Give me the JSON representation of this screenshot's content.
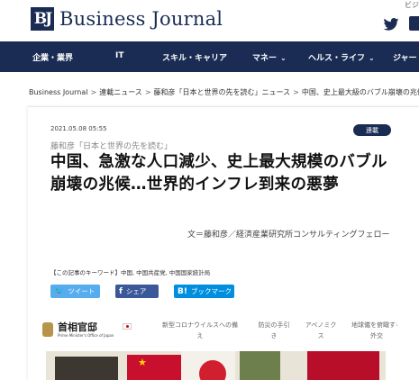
{
  "header": {
    "logo_mark": "BJ",
    "logo_text": "Business Journal",
    "top_right_text": "ビジ",
    "icons": [
      "twitter-icon",
      "facebook-icon"
    ]
  },
  "nav": {
    "items": [
      {
        "label": "企業・業界",
        "dropdown": false
      },
      {
        "label": "IT",
        "dropdown": false
      },
      {
        "label": "スキル・キャリア",
        "dropdown": false
      },
      {
        "label": "マネー",
        "dropdown": true
      },
      {
        "label": "ヘルス・ライフ",
        "dropdown": true
      },
      {
        "label": "ジャー",
        "dropdown": false
      }
    ],
    "chevron": "⌄",
    "background": "#1a2c54"
  },
  "breadcrumb": {
    "items": [
      "Business Journal",
      "連載ニュース",
      "藤和彦「日本と世界の先を読む」ニュース",
      "中国、史上最大級のバブル崩壊の兆候"
    ],
    "separator": ">"
  },
  "article": {
    "date": "2021.05.08 05:55",
    "badge": "連載",
    "series": "藤和彦「日本と世界の先を読む」",
    "title": "中国、急激な人口減少、史上最大規模のバブル崩壊の兆候…世界的インフレ到来の悪夢",
    "byline": "文＝藤和彦／経済産業研究所コンサルティングフェロー",
    "keywords_label": "【この記事のキーワード】",
    "keywords": [
      "中国",
      "中国共産党",
      "中国国家統計局"
    ]
  },
  "share": {
    "twitter": {
      "icon": "twitter-icon",
      "glyph": "🐦",
      "label": "ツイート",
      "color": "#55acee"
    },
    "facebook": {
      "icon": "facebook-icon",
      "glyph": "f",
      "label": "シェア",
      "color": "#3b5998"
    },
    "hatena": {
      "icon": "hatena-bookmark-icon",
      "glyph": "B!",
      "label": "ブックマーク",
      "color": "#008fde"
    }
  },
  "embedded_image": {
    "site_name": "首相官邸",
    "site_sub": "Prime Minister's Office of Japan",
    "nav": [
      {
        "line1": "新型コロナウイルスへの備",
        "line2": "え"
      },
      {
        "line1": "防災の手引",
        "line2": "き"
      },
      {
        "line1": "アベノミク",
        "line2": "ス"
      },
      {
        "line1": "地球儀を俯瞰する",
        "line2": "外交"
      }
    ]
  }
}
